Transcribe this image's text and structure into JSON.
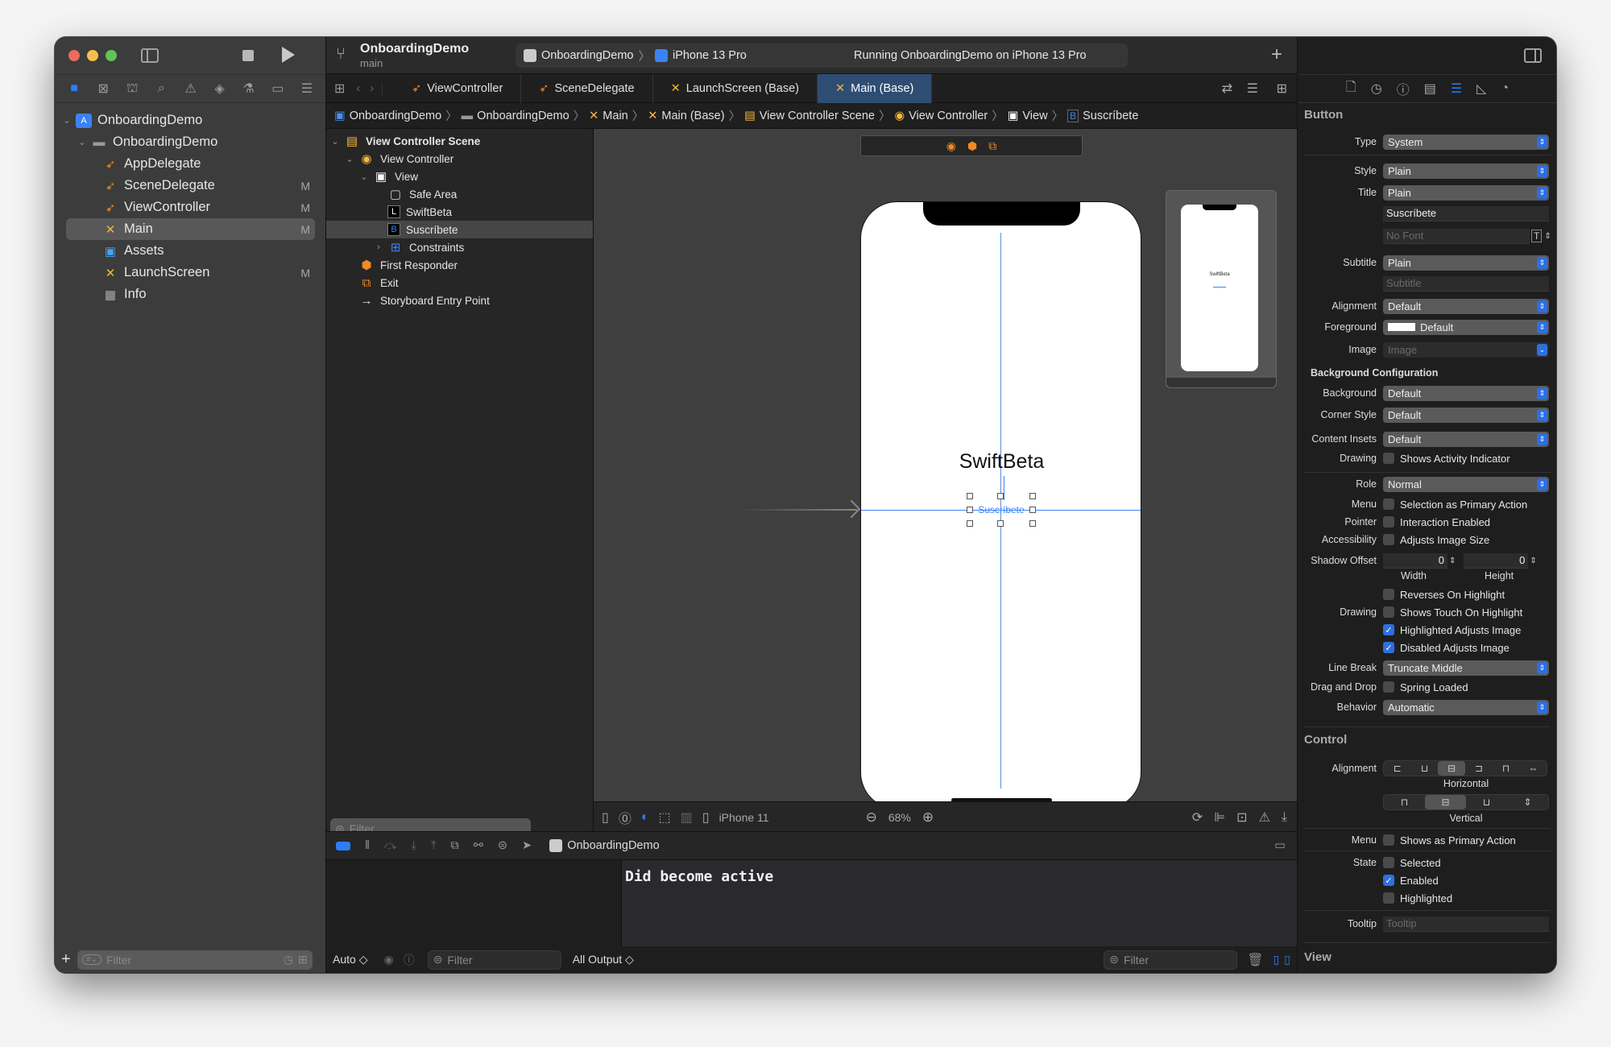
{
  "window": {
    "traffic_lights": {
      "close": "#ed6a5e",
      "minimize": "#f5bf4f",
      "zoom": "#61c554"
    }
  },
  "navigator": {
    "toolbar_icons": [
      "folder-icon",
      "source-control-icon",
      "hierarchy-icon",
      "search-icon",
      "warning-icon",
      "test-diamond-icon",
      "debug-spray-icon",
      "breakpoint-icon",
      "report-icon"
    ],
    "tree": [
      {
        "label": "OnboardingDemo",
        "icon": "xcode-project-icon",
        "level": 0,
        "expanded": true,
        "badge": ""
      },
      {
        "label": "OnboardingDemo",
        "icon": "folder-icon",
        "level": 1,
        "expanded": true,
        "badge": ""
      },
      {
        "label": "AppDelegate",
        "icon": "swift-file-icon",
        "level": 2,
        "badge": ""
      },
      {
        "label": "SceneDelegate",
        "icon": "swift-file-icon",
        "level": 2,
        "badge": "M"
      },
      {
        "label": "ViewController",
        "icon": "swift-file-icon",
        "level": 2,
        "badge": "M"
      },
      {
        "label": "Main",
        "icon": "storyboard-icon",
        "level": 2,
        "badge": "M",
        "selected": true
      },
      {
        "label": "Assets",
        "icon": "asset-catalog-icon",
        "level": 2,
        "badge": ""
      },
      {
        "label": "LaunchScreen",
        "icon": "storyboard-icon",
        "level": 2,
        "badge": "M"
      },
      {
        "label": "Info",
        "icon": "plist-table-icon",
        "level": 2,
        "badge": ""
      }
    ],
    "filter_placeholder": "Filter"
  },
  "toolbar": {
    "project_name": "OnboardingDemo",
    "branch": "main",
    "scheme": "OnboardingDemo",
    "destination": "iPhone 13 Pro",
    "status": "Running OnboardingDemo on iPhone 13 Pro"
  },
  "tabs": [
    {
      "label": "ViewController",
      "icon": "swift-file-icon",
      "active": false
    },
    {
      "label": "SceneDelegate",
      "icon": "swift-file-icon",
      "active": false
    },
    {
      "label": "LaunchScreen (Base)",
      "icon": "storyboard-icon",
      "active": false
    },
    {
      "label": "Main (Base)",
      "icon": "storyboard-icon",
      "active": true
    }
  ],
  "jumpbar": [
    "OnboardingDemo",
    "OnboardingDemo",
    "Main",
    "Main (Base)",
    "View Controller Scene",
    "View Controller",
    "View",
    "Suscríbete"
  ],
  "outline": {
    "items": [
      {
        "label": "View Controller Scene",
        "level": 0,
        "chevron": "down",
        "icon": "scene-icon",
        "bold": true
      },
      {
        "label": "View Controller",
        "level": 1,
        "chevron": "down",
        "icon": "view-controller-icon"
      },
      {
        "label": "View",
        "level": 2,
        "chevron": "down",
        "icon": "view-icon"
      },
      {
        "label": "Safe Area",
        "level": 3,
        "chevron": "",
        "icon": "safe-area-icon"
      },
      {
        "label": "SwiftBeta",
        "level": 3,
        "chevron": "",
        "icon": "label-icon",
        "glyph": "L"
      },
      {
        "label": "Suscríbete",
        "level": 3,
        "chevron": "",
        "icon": "button-icon",
        "glyph": "B",
        "selected": true
      },
      {
        "label": "Constraints",
        "level": 3,
        "chevron": "right",
        "icon": "constraints-icon"
      },
      {
        "label": "First Responder",
        "level": 1,
        "chevron": "",
        "icon": "first-responder-icon"
      },
      {
        "label": "Exit",
        "level": 1,
        "chevron": "",
        "icon": "exit-icon"
      },
      {
        "label": "Storyboard Entry Point",
        "level": 1,
        "chevron": "",
        "icon": "entry-arrow-icon"
      }
    ],
    "filter_placeholder": "Filter"
  },
  "canvas": {
    "label_text": "SwiftBeta",
    "button_text": "Suscríbete",
    "device": "iPhone 11",
    "zoom": "68%",
    "accent": "#2e6fe0"
  },
  "debug": {
    "process": "OnboardingDemo",
    "console_output": "Did become active",
    "variables_mode": "Auto ◇",
    "output_mode": "All Output ◇",
    "filter_placeholder": "Filter"
  },
  "inspector": {
    "tabs": [
      "file-icon",
      "history-icon",
      "help-icon",
      "identity-icon",
      "attributes-icon",
      "size-ruler-icon",
      "connections-icon"
    ],
    "section_button": "Button",
    "type": {
      "label": "Type",
      "value": "System"
    },
    "style": {
      "label": "Style",
      "value": "Plain"
    },
    "title": {
      "label": "Title",
      "value": "Plain"
    },
    "title_text": "Suscríbete",
    "font_placeholder": "No Font",
    "subtitle": {
      "label": "Subtitle",
      "value": "Plain"
    },
    "subtitle_placeholder": "Subtitle",
    "alignment": {
      "label": "Alignment",
      "value": "Default"
    },
    "foreground": {
      "label": "Foreground",
      "value": "Default"
    },
    "image": {
      "label": "Image",
      "placeholder": "Image"
    },
    "bg_config_header": "Background Configuration",
    "background": {
      "label": "Background",
      "value": "Default"
    },
    "corner_style": {
      "label": "Corner Style",
      "value": "Default"
    },
    "content_insets": {
      "label": "Content Insets",
      "value": "Default"
    },
    "drawing_activity": {
      "label": "Drawing",
      "text": "Shows Activity Indicator",
      "checked": false
    },
    "role": {
      "label": "Role",
      "value": "Normal"
    },
    "menu_primary": {
      "label": "Menu",
      "text": "Selection as Primary Action",
      "checked": false
    },
    "pointer": {
      "label": "Pointer",
      "text": "Interaction Enabled",
      "checked": false
    },
    "accessibility": {
      "label": "Accessibility",
      "text": "Adjusts Image Size",
      "checked": false
    },
    "shadow_offset": {
      "label": "Shadow Offset",
      "width": "0",
      "height": "0",
      "width_label": "Width",
      "height_label": "Height"
    },
    "reverses": {
      "text": "Reverses On Highlight",
      "checked": false
    },
    "shows_touch": {
      "label": "Drawing",
      "text": "Shows Touch On Highlight",
      "checked": false
    },
    "highlighted_adjusts": {
      "text": "Highlighted Adjusts Image",
      "checked": true
    },
    "disabled_adjusts": {
      "text": "Disabled Adjusts Image",
      "checked": true
    },
    "line_break": {
      "label": "Line Break",
      "value": "Truncate Middle"
    },
    "drag_drop": {
      "label": "Drag and Drop",
      "text": "Spring Loaded",
      "checked": false
    },
    "behavior": {
      "label": "Behavior",
      "value": "Automatic"
    },
    "control_header": "Control",
    "control_alignment_label": "Alignment",
    "horizontal_label": "Horizontal",
    "vertical_label": "Vertical",
    "horizontal_selected_index": 2,
    "vertical_selected_index": 1,
    "control_menu": {
      "label": "Menu",
      "text": "Shows as Primary Action",
      "checked": false
    },
    "state_label": "State",
    "state_selected": {
      "text": "Selected",
      "checked": false
    },
    "state_enabled": {
      "text": "Enabled",
      "checked": true
    },
    "state_highlighted": {
      "text": "Highlighted",
      "checked": false
    },
    "tooltip": {
      "label": "Tooltip",
      "placeholder": "Tooltip"
    },
    "view_header": "View"
  }
}
